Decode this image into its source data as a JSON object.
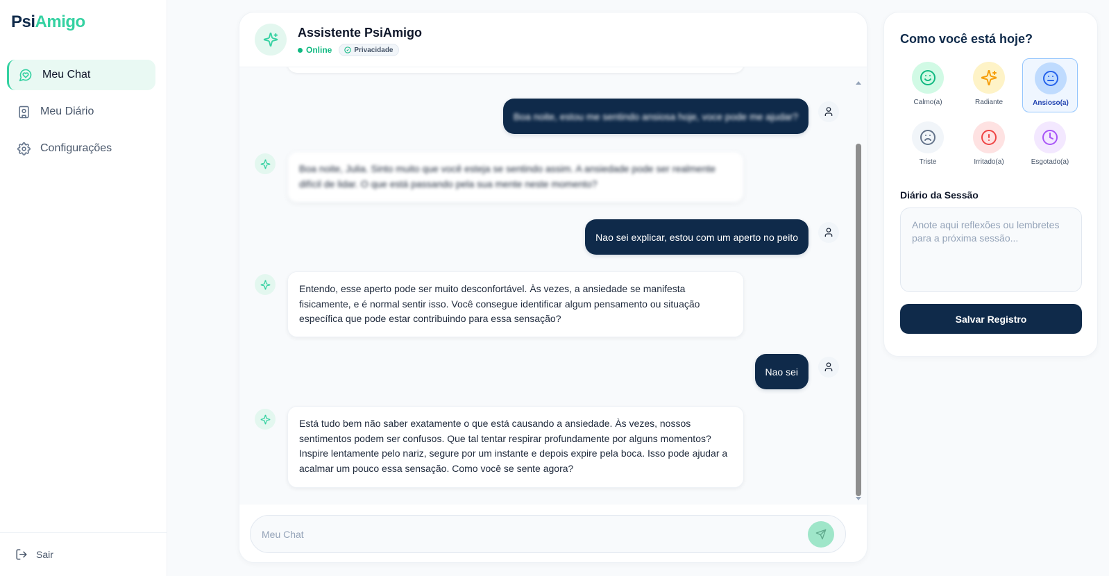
{
  "app": {
    "logo_part1": "Psi",
    "logo_part2": "Amigo"
  },
  "sidebar": {
    "items": [
      {
        "label": "Meu Chat",
        "icon": "chat-heart-icon",
        "active": true
      },
      {
        "label": "Meu Diário",
        "icon": "journal-icon",
        "active": false
      },
      {
        "label": "Configurações",
        "icon": "gear-icon",
        "active": false
      }
    ],
    "logout_label": "Sair"
  },
  "chat": {
    "title": "Assistente PsiAmigo",
    "status": "Online",
    "privacy_label": "Privacidade",
    "messages": [
      {
        "role": "user",
        "text": "Boa noite, estou me sentindo ansiosa hoje, voce pode me ajudar?",
        "blurred": true
      },
      {
        "role": "bot",
        "text": "Boa noite, Julia. Sinto muito que você esteja se sentindo assim. A ansiedade pode ser realmente difícil de lidar. O que está passando pela sua mente neste momento?",
        "blurred": true
      },
      {
        "role": "user",
        "text": "Nao sei explicar, estou com um aperto no peito"
      },
      {
        "role": "bot",
        "text": "Entendo, esse aperto pode ser muito desconfortável. Às vezes, a ansiedade se manifesta fisicamente, e é normal sentir isso. Você consegue identificar algum pensamento ou situação específica que pode estar contribuindo para essa sensação?"
      },
      {
        "role": "user",
        "text": "Nao sei"
      },
      {
        "role": "bot",
        "text": "Está tudo bem não saber exatamente o que está causando a ansiedade. Às vezes, nossos sentimentos podem ser confusos. Que tal tentar respirar profundamente por alguns momentos? Inspire lentamente pelo nariz, segure por um instante e depois expire pela boca. Isso pode ajudar a acalmar um pouco essa sensação. Como você se sente agora?"
      }
    ],
    "input_placeholder": "Meu Chat"
  },
  "mood": {
    "title": "Como você está hoje?",
    "options": [
      {
        "label": "Calmo(a)",
        "icon": "smile-icon",
        "bg": "#d1fae5",
        "color": "#10b981",
        "selected": false
      },
      {
        "label": "Radiante",
        "icon": "sparkles-icon",
        "bg": "#fef3c7",
        "color": "#f59e0b",
        "selected": false
      },
      {
        "label": "Ansioso(a)",
        "icon": "neutral-face-icon",
        "bg": "#bfdbfe",
        "color": "#2563eb",
        "selected": true
      },
      {
        "label": "Triste",
        "icon": "sad-face-icon",
        "bg": "#f1f5f9",
        "color": "#64748b",
        "selected": false
      },
      {
        "label": "Irritado(a)",
        "icon": "alert-circle-icon",
        "bg": "#fee2e2",
        "color": "#ef4444",
        "selected": false
      },
      {
        "label": "Esgotado(a)",
        "icon": "clock-icon",
        "bg": "#f3e8ff",
        "color": "#a855f7",
        "selected": false
      }
    ]
  },
  "diary": {
    "label": "Diário da Sessão",
    "placeholder": "Anote aqui reflexões ou lembretes para a próxima sessão...",
    "save_label": "Salvar Registro"
  }
}
